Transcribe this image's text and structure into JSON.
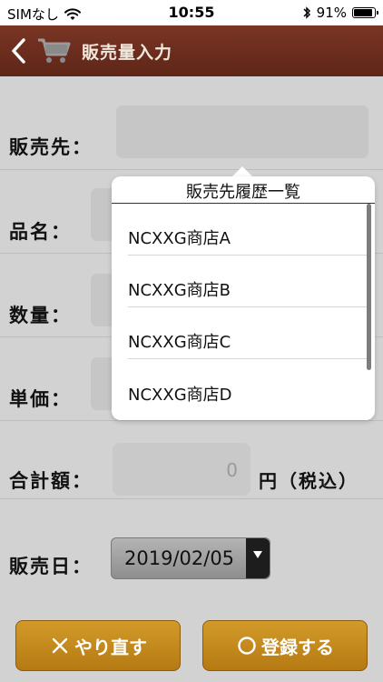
{
  "status_bar": {
    "carrier": "SIMなし",
    "time": "10:55",
    "battery": "91%",
    "battery_level": 0.91
  },
  "nav": {
    "title": "販売量入力"
  },
  "form": {
    "customer_label": "販売先：",
    "product_label": "品名：",
    "quantity_label": "数量：",
    "unit_price_label": "単価：",
    "total_label": "合計額：",
    "total_value": "0",
    "total_unit": "円（税込）",
    "date_label": "販売日：",
    "date_value": "2019/02/05"
  },
  "popup": {
    "title": "販売先履歴一覧",
    "items": [
      "NCXXG商店A",
      "NCXXG商店B",
      "NCXXG商店C",
      "NCXXG商店D"
    ]
  },
  "buttons": {
    "reset_label": "やり直す",
    "register_label": "登録する"
  },
  "colors": {
    "nav_bg": "#6b2d1e",
    "button_bg": "#c48a1e"
  }
}
